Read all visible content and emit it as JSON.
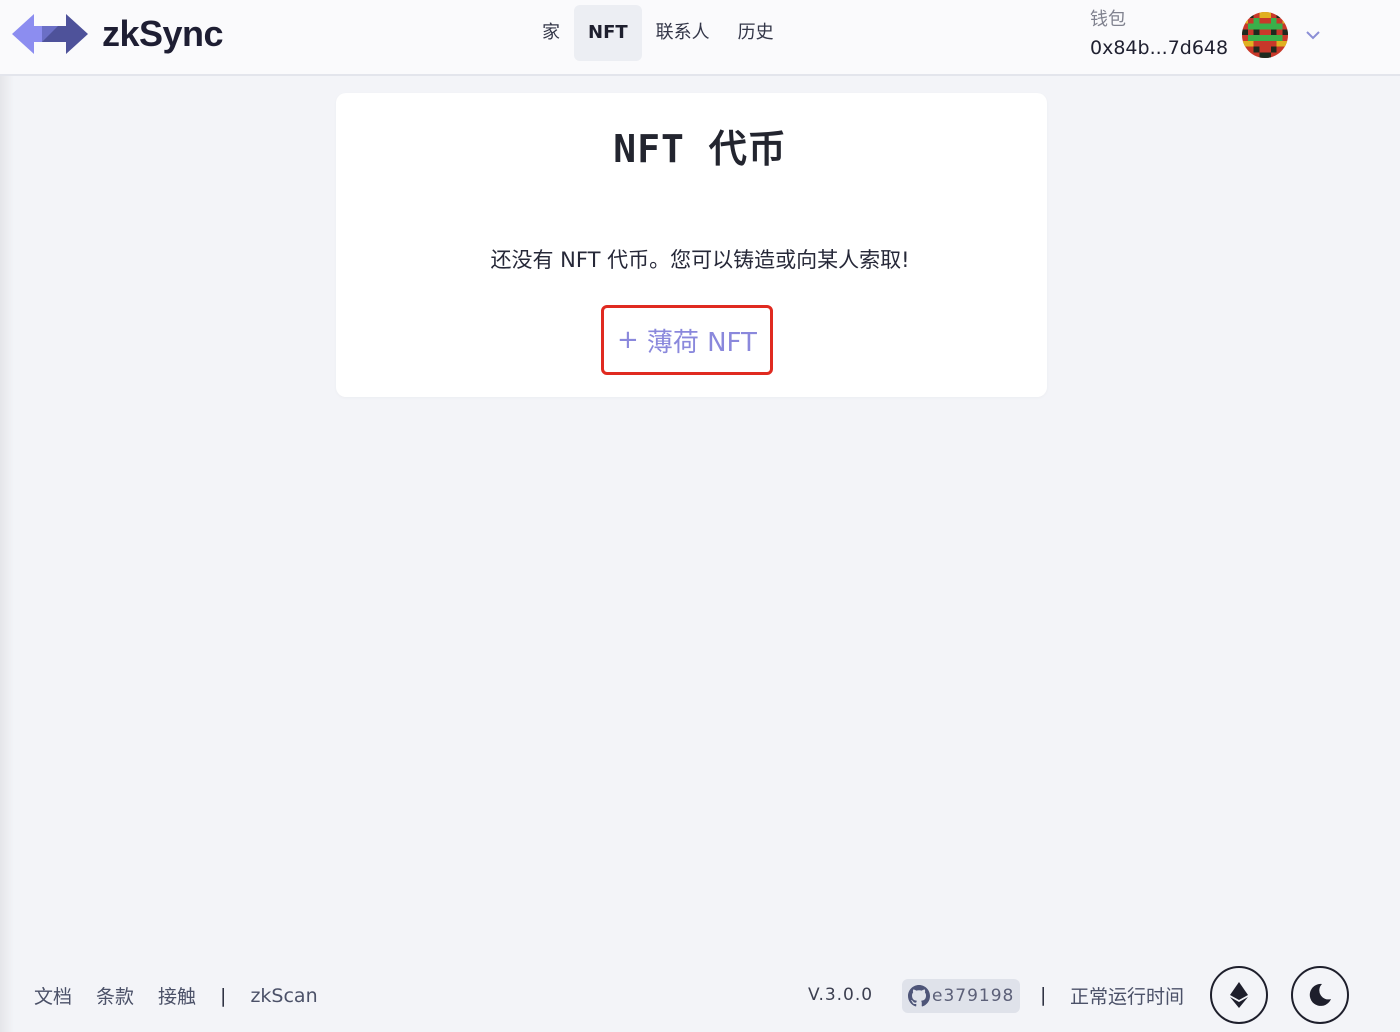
{
  "header": {
    "logo_text": "zkSync",
    "nav": [
      {
        "label": "家",
        "active": false
      },
      {
        "label": "NFT",
        "active": true
      },
      {
        "label": "联系人",
        "active": false
      },
      {
        "label": "历史",
        "active": false
      }
    ],
    "wallet_label": "钱包",
    "wallet_address": "0x84b...7d648",
    "icons": {
      "logo": "zksync-logo-icon",
      "avatar": "pixel-avatar",
      "dropdown": "chevron-down-icon"
    }
  },
  "main": {
    "title": "NFT 代币",
    "empty_message": "还没有 NFT 代币。您可以铸造或向某人索取!",
    "mint_button": {
      "plus": "+",
      "label": "薄荷 NFT"
    }
  },
  "footer": {
    "links": [
      "文档",
      "条款",
      "接触"
    ],
    "separator": "|",
    "zkscan": "zkScan",
    "version": "V.3.0.0",
    "commit": "e379198",
    "uptime": "正常运行时间",
    "icons": {
      "github": "github-icon",
      "ethereum": "ethereum-icon",
      "theme": "moon-icon"
    }
  },
  "colors": {
    "background": "#f3f4f8",
    "accent": "#8a88dc",
    "highlight_border": "#e02a20",
    "logo_light": "#8c8df0",
    "logo_dark": "#4e529a"
  }
}
